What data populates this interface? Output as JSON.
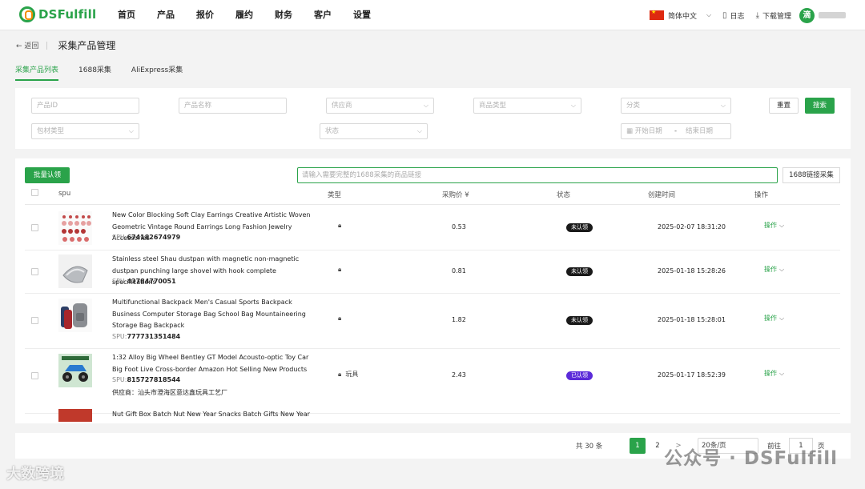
{
  "brand": {
    "name": "DSFulfill"
  },
  "nav": [
    "首页",
    "产品",
    "报价",
    "履约",
    "财务",
    "客户",
    "设置"
  ],
  "topright": {
    "language": "简体中文",
    "log": "日志",
    "download": "下载管理",
    "avatar_char": "滴"
  },
  "breadcrumb": {
    "back": "返回",
    "title": "采集产品管理"
  },
  "tabs": [
    "采集产品列表",
    "1688采集",
    "AliExpress采集"
  ],
  "filters": {
    "product_id": "产品ID",
    "product_name": "产品名称",
    "supplier": "供应商",
    "category": "商品类型",
    "classify": "分类",
    "packaging": "包材类型",
    "status": "状态",
    "start_date": "开始日期",
    "end_date": "结束日期",
    "reset": "重置",
    "search": "搜索"
  },
  "toolbar": {
    "batch_claim": "批量认领",
    "link_placeholder": "请输入需要完整的1688采集的商品链接",
    "link_button": "1688链接采集"
  },
  "table": {
    "headers": {
      "spu": "spu",
      "type": "类型",
      "price": "采购价 ¥",
      "status": "状态",
      "created": "创建时间",
      "action": "操作"
    },
    "rows": [
      {
        "title": "New Color Blocking Soft Clay Earrings Creative Artistic Woven Geometric Vintage Round Earrings Long Fashion Jewelry Accessories",
        "spu_label": "SPU:",
        "spu": "674182674979",
        "type": "",
        "price": "0.53",
        "status": "未认领",
        "created": "2025-02-07 18:31:20",
        "action": "操作"
      },
      {
        "title": "Stainless steel Shau dustpan with magnetic non-magnetic dustpan punching large shovel with hook complete specifications",
        "spu_label": "SPU:",
        "spu": "43784770051",
        "type": "",
        "price": "0.81",
        "status": "未认领",
        "created": "2025-01-18 15:28:26",
        "action": "操作"
      },
      {
        "title": "Multifunctional Backpack Men's Casual Sports Backpack Business Computer Storage Bag School Bag Mountaineering Storage Bag Backpack",
        "spu_label": "SPU:",
        "spu": "777731351484",
        "type": "",
        "price": "1.82",
        "status": "未认领",
        "created": "2025-01-18 15:28:01",
        "action": "操作"
      },
      {
        "title": "1:32 Alloy Big Wheel Bentley GT Model Acousto-optic Toy Car Big Foot Live Cross-border Amazon Hot Selling New Products",
        "spu_label": "SPU:",
        "spu": "815727818544",
        "supplier": "供应商：汕头市澄海区意达鑫玩具工艺厂",
        "type": "玩具",
        "price": "2.43",
        "status": "已认领",
        "created": "2025-01-17 18:52:39",
        "action": "操作"
      },
      {
        "title": "Nut Gift Box Batch Nut New Year Snacks Batch Gifts New Year",
        "spu_label": "",
        "spu": ""
      }
    ]
  },
  "pagination": {
    "total": "共 30 条",
    "pages": [
      "1",
      "2"
    ],
    "next": ">",
    "page_size": "20条/页",
    "goto_label": "前往",
    "goto_value": "1",
    "page_unit": "页"
  },
  "watermarks": {
    "right": "公众号 · DSFulfill",
    "left": "大数跨境"
  },
  "colors": {
    "accent": "#2aa34a",
    "unclaimed": "#1a1a1a",
    "claimed": "#5b2bd9"
  }
}
